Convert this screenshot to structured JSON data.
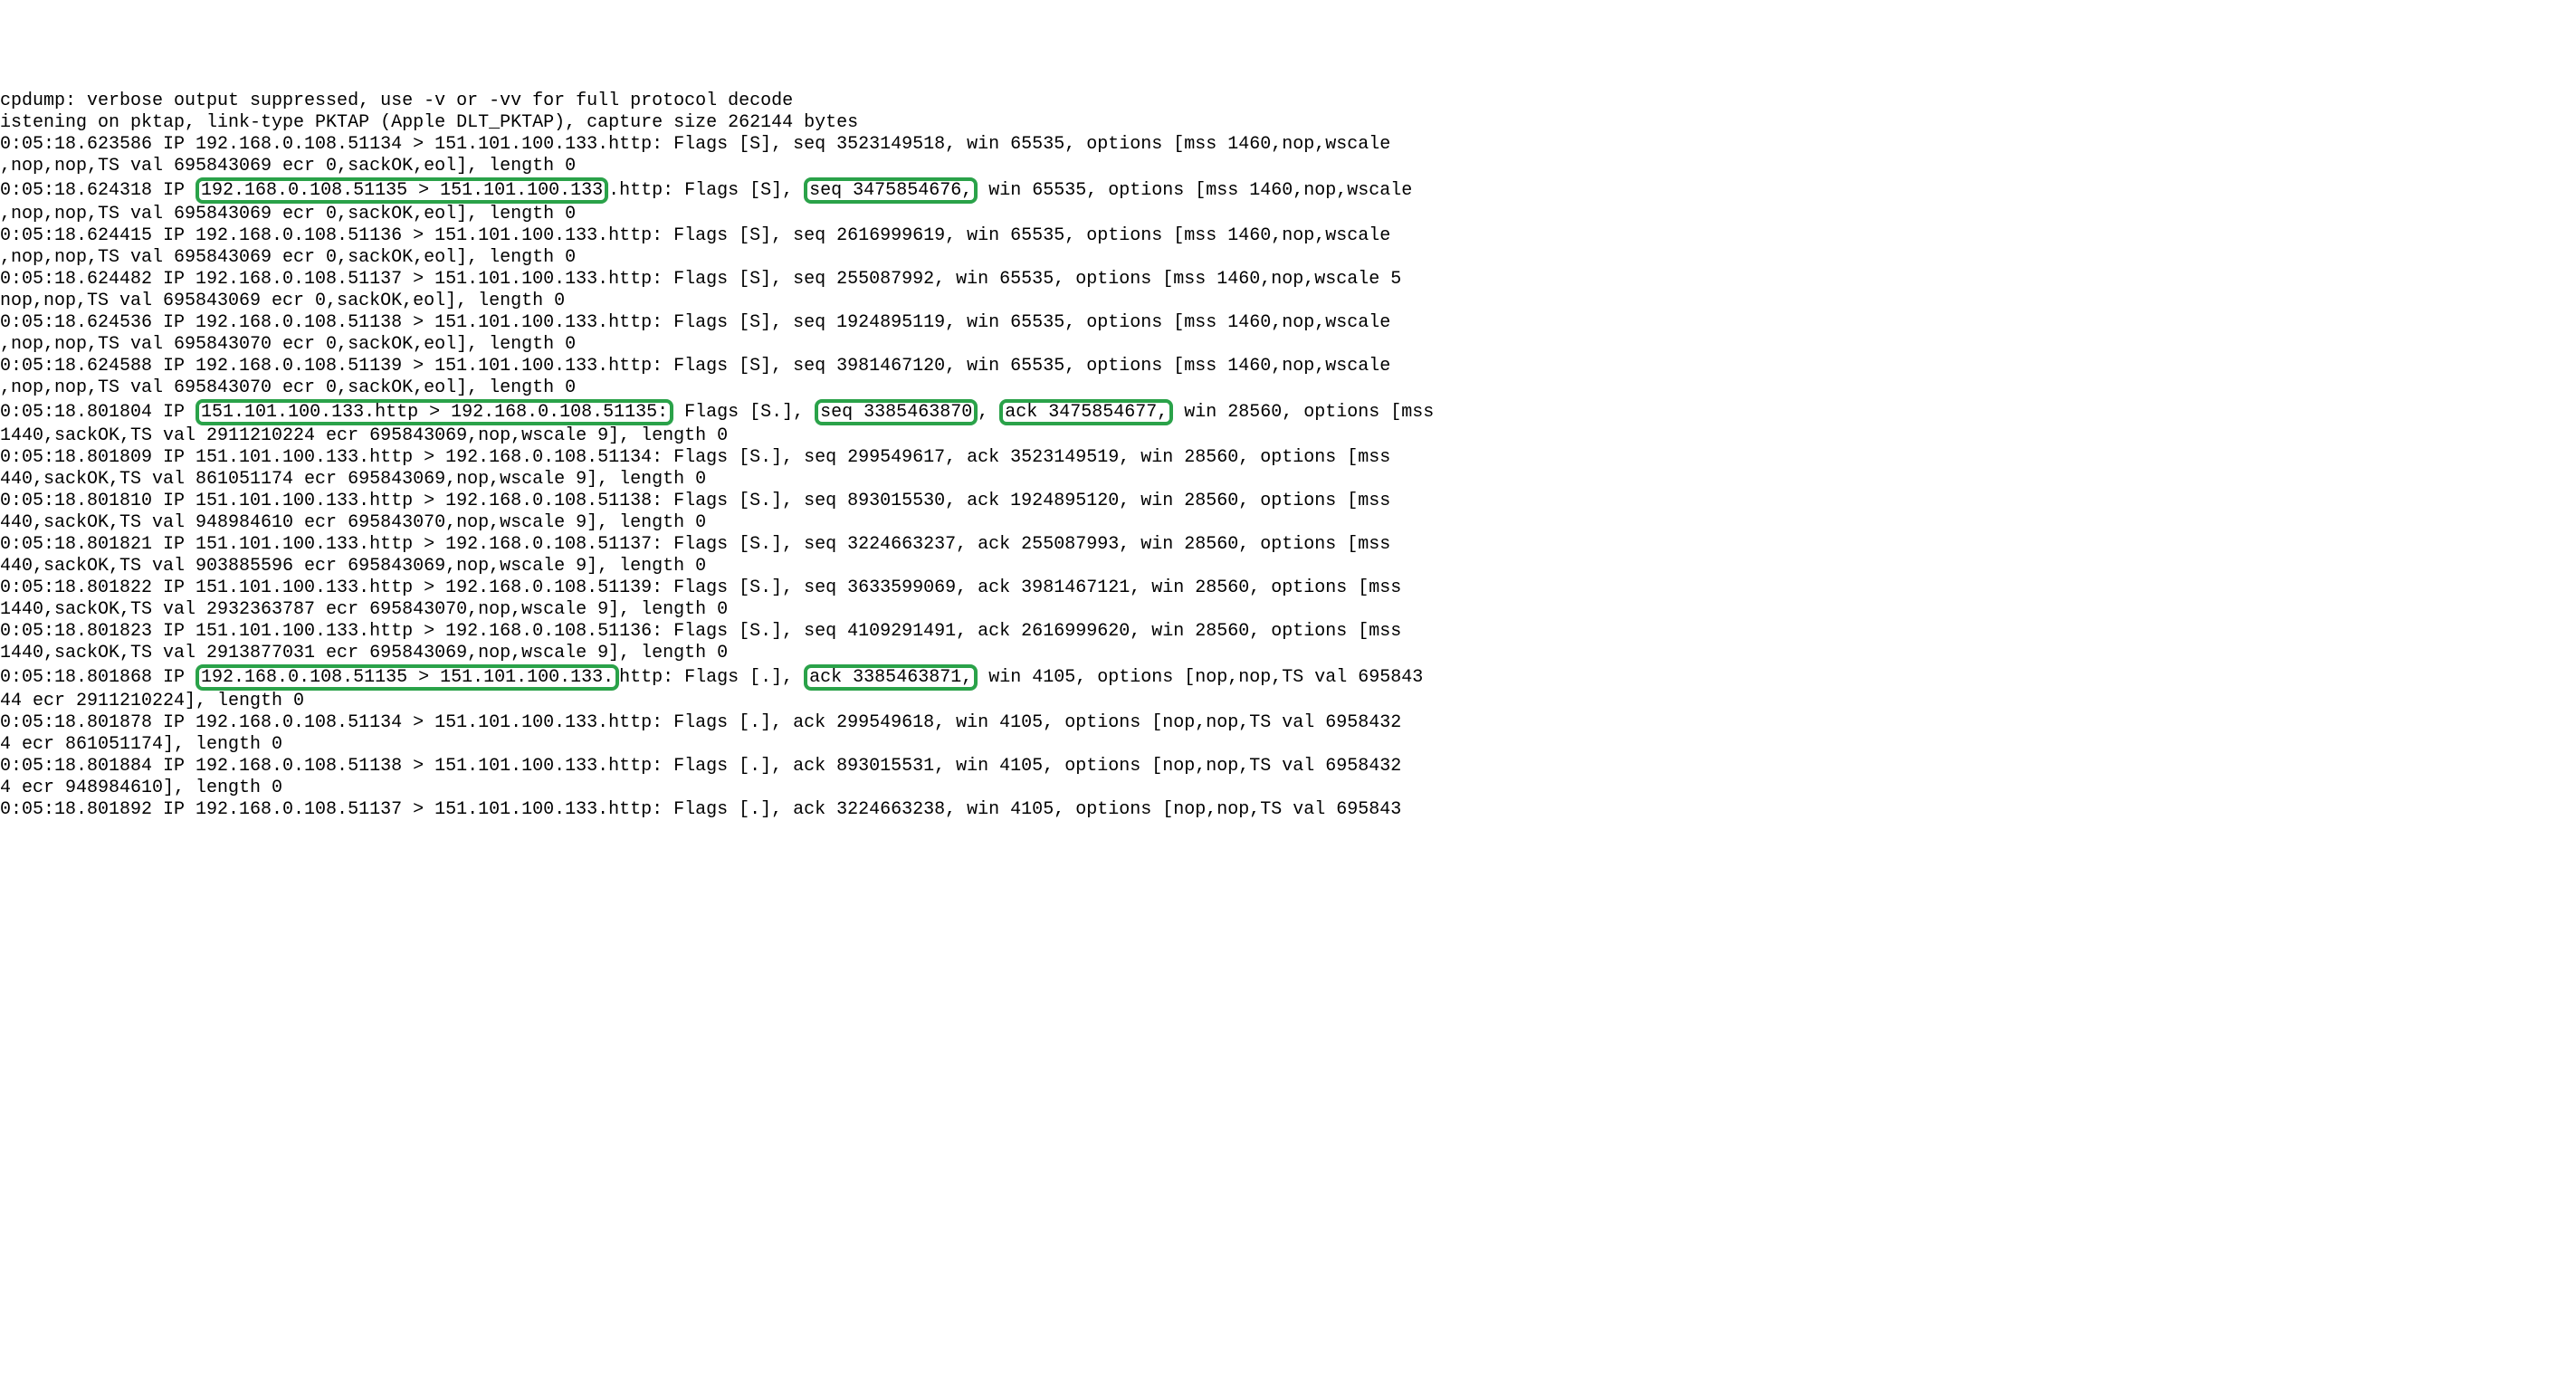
{
  "header": {
    "l1": "cpdump: verbose output suppressed, use -v or -vv for full protocol decode",
    "l2": "istening on pktap, link-type PKTAP (Apple DLT_PKTAP), capture size 262144 bytes"
  },
  "p01": {
    "a": "0:05:18.623586 IP 192.168.0.108.51134 > 151.101.100.133.http: Flags [S], seq 3523149518, win 65535, options [mss 1460,nop,wscale",
    "b": ",nop,nop,TS val 695843069 ecr 0,sackOK,eol], length 0"
  },
  "p02": {
    "pre": "0:05:18.624318 IP ",
    "hl1": "192.168.0.108.51135 > 151.101.100.133",
    "mid1": ".http: Flags [S], ",
    "hl2": "seq 3475854676,",
    "post": " win 65535, options [mss 1460,nop,wscale",
    "b": ",nop,nop,TS val 695843069 ecr 0,sackOK,eol], length 0"
  },
  "p03": {
    "a": "0:05:18.624415 IP 192.168.0.108.51136 > 151.101.100.133.http: Flags [S], seq 2616999619, win 65535, options [mss 1460,nop,wscale",
    "b": ",nop,nop,TS val 695843069 ecr 0,sackOK,eol], length 0"
  },
  "p04": {
    "a": "0:05:18.624482 IP 192.168.0.108.51137 > 151.101.100.133.http: Flags [S], seq 255087992, win 65535, options [mss 1460,nop,wscale 5",
    "b": "nop,nop,TS val 695843069 ecr 0,sackOK,eol], length 0"
  },
  "p05": {
    "a": "0:05:18.624536 IP 192.168.0.108.51138 > 151.101.100.133.http: Flags [S], seq 1924895119, win 65535, options [mss 1460,nop,wscale",
    "b": ",nop,nop,TS val 695843070 ecr 0,sackOK,eol], length 0"
  },
  "p06": {
    "a": "0:05:18.624588 IP 192.168.0.108.51139 > 151.101.100.133.http: Flags [S], seq 3981467120, win 65535, options [mss 1460,nop,wscale",
    "b": ",nop,nop,TS val 695843070 ecr 0,sackOK,eol], length 0"
  },
  "p07": {
    "pre": "0:05:18.801804 IP ",
    "hl1": "151.101.100.133.http > 192.168.0.108.51135:",
    "mid1": " Flags [S.], ",
    "hl2": "seq 3385463870",
    "mid2": ", ",
    "hl3": "ack 3475854677,",
    "post": " win 28560, options [mss",
    "b": "1440,sackOK,TS val 2911210224 ecr 695843069,nop,wscale 9], length 0"
  },
  "p08": {
    "a": "0:05:18.801809 IP 151.101.100.133.http > 192.168.0.108.51134: Flags [S.], seq 299549617, ack 3523149519, win 28560, options [mss",
    "b": "440,sackOK,TS val 861051174 ecr 695843069,nop,wscale 9], length 0"
  },
  "p09": {
    "a": "0:05:18.801810 IP 151.101.100.133.http > 192.168.0.108.51138: Flags [S.], seq 893015530, ack 1924895120, win 28560, options [mss",
    "b": "440,sackOK,TS val 948984610 ecr 695843070,nop,wscale 9], length 0"
  },
  "p10": {
    "a": "0:05:18.801821 IP 151.101.100.133.http > 192.168.0.108.51137: Flags [S.], seq 3224663237, ack 255087993, win 28560, options [mss",
    "b": "440,sackOK,TS val 903885596 ecr 695843069,nop,wscale 9], length 0"
  },
  "p11": {
    "a": "0:05:18.801822 IP 151.101.100.133.http > 192.168.0.108.51139: Flags [S.], seq 3633599069, ack 3981467121, win 28560, options [mss",
    "b": "1440,sackOK,TS val 2932363787 ecr 695843070,nop,wscale 9], length 0"
  },
  "p12": {
    "a": "0:05:18.801823 IP 151.101.100.133.http > 192.168.0.108.51136: Flags [S.], seq 4109291491, ack 2616999620, win 28560, options [mss",
    "b": "1440,sackOK,TS val 2913877031 ecr 695843069,nop,wscale 9], length 0"
  },
  "p13": {
    "pre": "0:05:18.801868 IP ",
    "hl1": "192.168.0.108.51135 > 151.101.100.133.",
    "mid1": "http: Flags [.], ",
    "hl2": "ack 3385463871,",
    "post": " win 4105, options [nop,nop,TS val 695843",
    "b": "44 ecr 2911210224], length 0"
  },
  "p14": {
    "a": "0:05:18.801878 IP 192.168.0.108.51134 > 151.101.100.133.http: Flags [.], ack 299549618, win 4105, options [nop,nop,TS val 6958432",
    "b": "4 ecr 861051174], length 0"
  },
  "p15": {
    "a": "0:05:18.801884 IP 192.168.0.108.51138 > 151.101.100.133.http: Flags [.], ack 893015531, win 4105, options [nop,nop,TS val 6958432",
    "b": "4 ecr 948984610], length 0"
  },
  "p16": {
    "a": "0:05:18.801892 IP 192.168.0.108.51137 > 151.101.100.133.http: Flags [.], ack 3224663238, win 4105, options [nop,nop,TS val 695843"
  },
  "captured": {
    "packets": [
      {
        "ts": "0:05:18.623586",
        "src": "192.168.0.108",
        "sport": 51134,
        "dst": "151.101.100.133",
        "dport": "http",
        "flags": "S",
        "seq": 3523149518,
        "win": 65535,
        "opts": "mss 1460,nop,wscale,nop,nop,TS val 695843069 ecr 0,sackOK,eol",
        "len": 0
      },
      {
        "ts": "0:05:18.624318",
        "src": "192.168.0.108",
        "sport": 51135,
        "dst": "151.101.100.133",
        "dport": "http",
        "flags": "S",
        "seq": 3475854676,
        "win": 65535,
        "opts": "mss 1460,nop,wscale,nop,nop,TS val 695843069 ecr 0,sackOK,eol",
        "len": 0
      },
      {
        "ts": "0:05:18.624415",
        "src": "192.168.0.108",
        "sport": 51136,
        "dst": "151.101.100.133",
        "dport": "http",
        "flags": "S",
        "seq": 2616999619,
        "win": 65535,
        "opts": "mss 1460,nop,wscale,nop,nop,TS val 695843069 ecr 0,sackOK,eol",
        "len": 0
      },
      {
        "ts": "0:05:18.624482",
        "src": "192.168.0.108",
        "sport": 51137,
        "dst": "151.101.100.133",
        "dport": "http",
        "flags": "S",
        "seq": 255087992,
        "win": 65535,
        "opts": "mss 1460,nop,wscale 5,nop,nop,TS val 695843069 ecr 0,sackOK,eol",
        "len": 0
      },
      {
        "ts": "0:05:18.624536",
        "src": "192.168.0.108",
        "sport": 51138,
        "dst": "151.101.100.133",
        "dport": "http",
        "flags": "S",
        "seq": 1924895119,
        "win": 65535,
        "opts": "mss 1460,nop,wscale,nop,nop,TS val 695843070 ecr 0,sackOK,eol",
        "len": 0
      },
      {
        "ts": "0:05:18.624588",
        "src": "192.168.0.108",
        "sport": 51139,
        "dst": "151.101.100.133",
        "dport": "http",
        "flags": "S",
        "seq": 3981467120,
        "win": 65535,
        "opts": "mss 1460,nop,wscale,nop,nop,TS val 695843070 ecr 0,sackOK,eol",
        "len": 0
      },
      {
        "ts": "0:05:18.801804",
        "src": "151.101.100.133",
        "sport": "http",
        "dst": "192.168.0.108",
        "dport": 51135,
        "flags": "S.",
        "seq": 3385463870,
        "ack": 3475854677,
        "win": 28560,
        "opts": "mss 1440,sackOK,TS val 2911210224 ecr 695843069,nop,wscale 9",
        "len": 0
      },
      {
        "ts": "0:05:18.801809",
        "src": "151.101.100.133",
        "sport": "http",
        "dst": "192.168.0.108",
        "dport": 51134,
        "flags": "S.",
        "seq": 299549617,
        "ack": 3523149519,
        "win": 28560,
        "opts": "mss 440,sackOK,TS val 861051174 ecr 695843069,nop,wscale 9",
        "len": 0
      },
      {
        "ts": "0:05:18.801810",
        "src": "151.101.100.133",
        "sport": "http",
        "dst": "192.168.0.108",
        "dport": 51138,
        "flags": "S.",
        "seq": 893015530,
        "ack": 1924895120,
        "win": 28560,
        "opts": "mss 440,sackOK,TS val 948984610 ecr 695843070,nop,wscale 9",
        "len": 0
      },
      {
        "ts": "0:05:18.801821",
        "src": "151.101.100.133",
        "sport": "http",
        "dst": "192.168.0.108",
        "dport": 51137,
        "flags": "S.",
        "seq": 3224663237,
        "ack": 255087993,
        "win": 28560,
        "opts": "mss 440,sackOK,TS val 903885596 ecr 695843069,nop,wscale 9",
        "len": 0
      },
      {
        "ts": "0:05:18.801822",
        "src": "151.101.100.133",
        "sport": "http",
        "dst": "192.168.0.108",
        "dport": 51139,
        "flags": "S.",
        "seq": 3633599069,
        "ack": 3981467121,
        "win": 28560,
        "opts": "mss 1440,sackOK,TS val 2932363787 ecr 695843070,nop,wscale 9",
        "len": 0
      },
      {
        "ts": "0:05:18.801823",
        "src": "151.101.100.133",
        "sport": "http",
        "dst": "192.168.0.108",
        "dport": 51136,
        "flags": "S.",
        "seq": 4109291491,
        "ack": 2616999620,
        "win": 28560,
        "opts": "mss 1440,sackOK,TS val 2913877031 ecr 695843069,nop,wscale 9",
        "len": 0
      },
      {
        "ts": "0:05:18.801868",
        "src": "192.168.0.108",
        "sport": 51135,
        "dst": "151.101.100.133",
        "dport": "http",
        "flags": ".",
        "ack": 3385463871,
        "win": 4105,
        "opts": "nop,nop,TS val 69584344 ecr 2911210224",
        "len": 0
      },
      {
        "ts": "0:05:18.801878",
        "src": "192.168.0.108",
        "sport": 51134,
        "dst": "151.101.100.133",
        "dport": "http",
        "flags": ".",
        "ack": 299549618,
        "win": 4105,
        "opts": "nop,nop,TS val 69584324 ecr 861051174",
        "len": 0
      },
      {
        "ts": "0:05:18.801884",
        "src": "192.168.0.108",
        "sport": 51138,
        "dst": "151.101.100.133",
        "dport": "http",
        "flags": ".",
        "ack": 893015531,
        "win": 4105,
        "opts": "nop,nop,TS val 69584324 ecr 948984610",
        "len": 0
      },
      {
        "ts": "0:05:18.801892",
        "src": "192.168.0.108",
        "sport": 51137,
        "dst": "151.101.100.133",
        "dport": "http",
        "flags": ".",
        "ack": 3224663238,
        "win": 4105,
        "opts": "nop,nop,TS val 695843",
        "len": 0
      }
    ]
  }
}
